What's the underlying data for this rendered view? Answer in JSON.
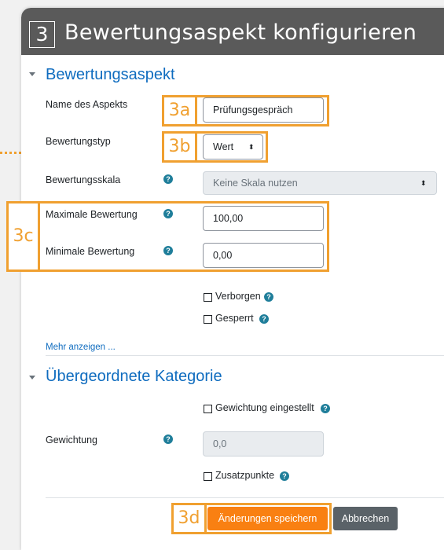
{
  "header": {
    "step_number": "3",
    "title": "Bewertungsaspekt konfigurieren"
  },
  "section_aspect": {
    "title": "Bewertungsaspekt",
    "name_label": "Name des Aspekts",
    "name_value": "Prüfungsgespräch",
    "type_label": "Bewertungstyp",
    "type_value": "Wert",
    "scale_label": "Bewertungsskala",
    "scale_value": "Keine Skala nutzen",
    "max_label": "Maximale Bewertung",
    "max_value": "100,00",
    "min_label": "Minimale Bewertung",
    "min_value": "0,00",
    "hidden_label": "Verborgen",
    "locked_label": "Gesperrt",
    "more_link": "Mehr anzeigen ..."
  },
  "section_parent": {
    "title": "Übergeordnete Kategorie",
    "weight_adjusted_label": "Gewichtung eingestellt",
    "weight_label": "Gewichtung",
    "weight_value": "0,0",
    "extra_credit_label": "Zusatzpunkte"
  },
  "buttons": {
    "save_label": "Änderungen speichern",
    "cancel_label": "Abbrechen"
  },
  "annotations": {
    "a": "3a",
    "b": "3b",
    "c": "3c",
    "d": "3d"
  },
  "icons": {
    "help": "question-circle-icon",
    "collapse": "chevron-down-icon",
    "select": "select-arrows-icon"
  },
  "colors": {
    "accent": "#f98012",
    "annotation": "#f0a030",
    "link": "#0f6cbf",
    "header": "#5a5a5a"
  }
}
